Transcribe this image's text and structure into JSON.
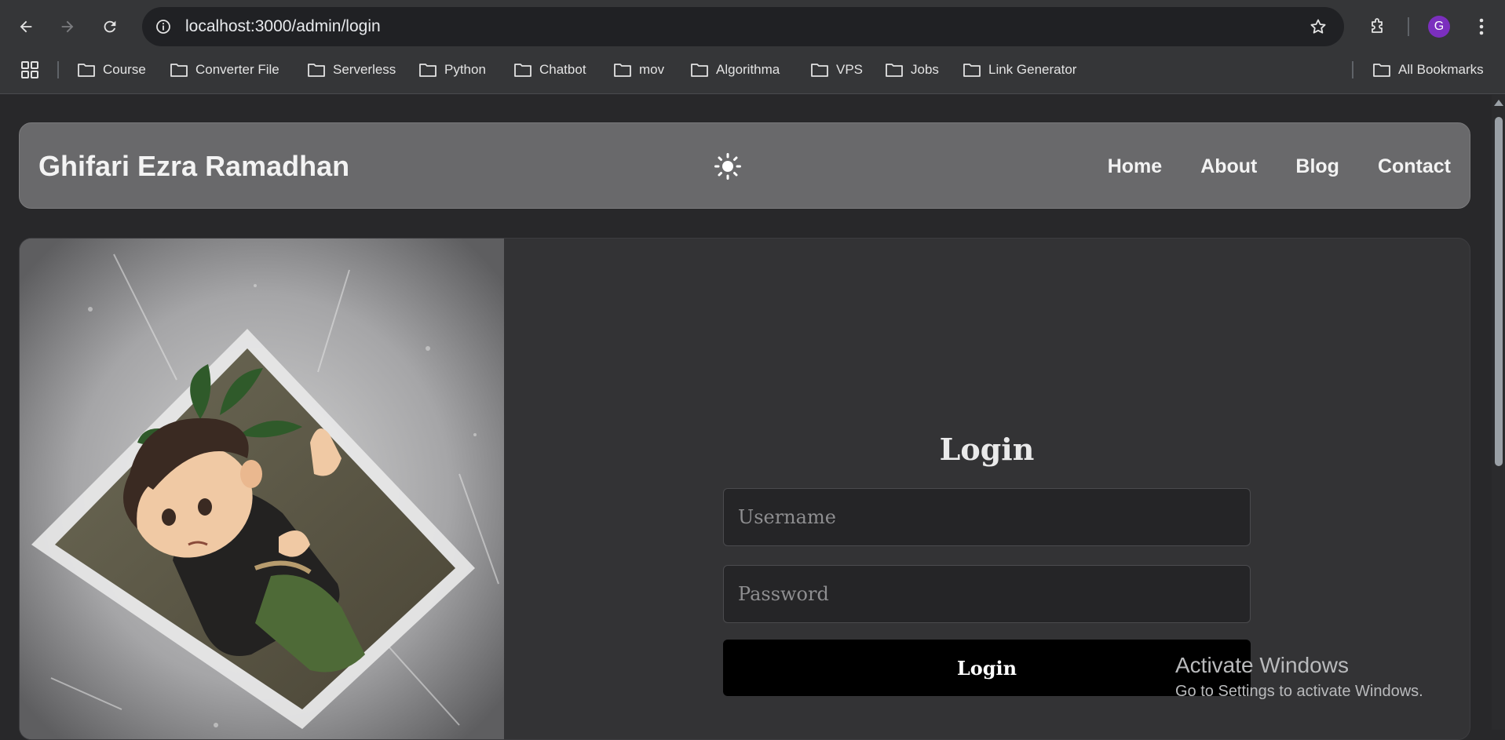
{
  "browser": {
    "url": "localhost:3000/admin/login",
    "profile_initial": "G",
    "profile_color": "#7b2fbe",
    "bookmarks": [
      {
        "label": "Course"
      },
      {
        "label": "Converter File"
      },
      {
        "label": "Serverless"
      },
      {
        "label": "Python"
      },
      {
        "label": "Chatbot"
      },
      {
        "label": "mov"
      },
      {
        "label": "Algorithma"
      },
      {
        "label": "VPS"
      },
      {
        "label": "Jobs"
      },
      {
        "label": "Link Generator"
      }
    ],
    "all_bookmarks": "All Bookmarks"
  },
  "site": {
    "brand": "Ghifari Ezra Ramadhan",
    "nav": [
      "Home",
      "About",
      "Blog",
      "Contact"
    ],
    "theme_icon": "sun-icon"
  },
  "login": {
    "title": "Login",
    "username_placeholder": "Username",
    "password_placeholder": "Password",
    "submit_label": "Login"
  },
  "watermark": {
    "line1": "Activate Windows",
    "line2": "Go to Settings to activate Windows."
  },
  "colors": {
    "page_bg": "#28282a",
    "navbar_bg": "#69696b",
    "card_bg": "#333335",
    "button_bg": "#000000"
  }
}
